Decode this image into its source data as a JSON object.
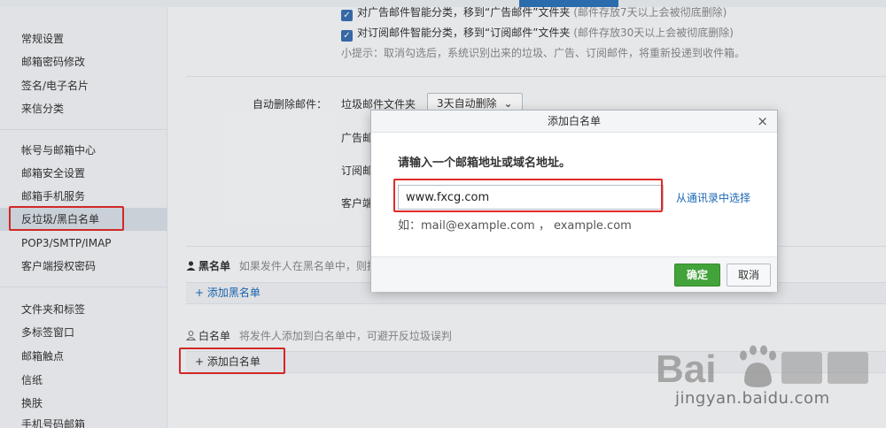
{
  "sidebar": {
    "groups": [
      [
        "常规设置",
        "邮箱密码修改",
        "签名/电子名片",
        "来信分类"
      ],
      [
        "帐号与邮箱中心",
        "邮箱安全设置",
        "邮箱手机服务",
        "反垃圾/黑白名单",
        "POP3/SMTP/IMAP",
        "客户端授权密码"
      ],
      [
        "文件夹和标签",
        "多标签窗口",
        "邮箱触点",
        "信纸",
        "换肤",
        "手机号码邮箱"
      ]
    ]
  },
  "main": {
    "ad_option": "对广告邮件智能分类，移到“广告邮件”文件夹",
    "ad_note": "(邮件存放7天以上会被彻底删除)",
    "sub_option": "对订阅邮件智能分类，移到“订阅邮件”文件夹",
    "sub_note": "(邮件存放30天以上会被彻底删除)",
    "tip": "小提示：取消勾选后，系统识别出来的垃圾、广告、订阅邮件，将重新投递到收件箱。",
    "auto_delete_label": "自动删除邮件：",
    "spam_folder": "垃圾邮件文件夹",
    "spam_select": "3天自动删除",
    "ad_folder_partial": "广告邮",
    "sub_folder_partial": "订阅邮",
    "client_partial": "客户端",
    "blacklist_title": "黑名单",
    "blacklist_desc": "如果发件人在黑名单中，则拒收",
    "add_blacklist": "+ 添加黑名单",
    "whitelist_title": "白名单",
    "whitelist_desc": "将发件人添加到白名单中，可避开反垃圾误判",
    "add_whitelist": "+ 添加白名单"
  },
  "modal": {
    "title": "添加白名单",
    "close": "×",
    "prompt": "请输入一个邮箱地址或域名地址。",
    "input_value": "www.fxcg.com",
    "contacts_link": "从通讯录中选择",
    "example": "如：mail@example.com ，  example.com",
    "ok": "确定",
    "cancel": "取消"
  },
  "watermark": {
    "url": "jingyan.baidu.com"
  },
  "colors": {
    "accent": "#2e73b8",
    "ok_button": "#43a33b",
    "highlight_box": "#e02a2a",
    "link": "#1c69b5"
  }
}
